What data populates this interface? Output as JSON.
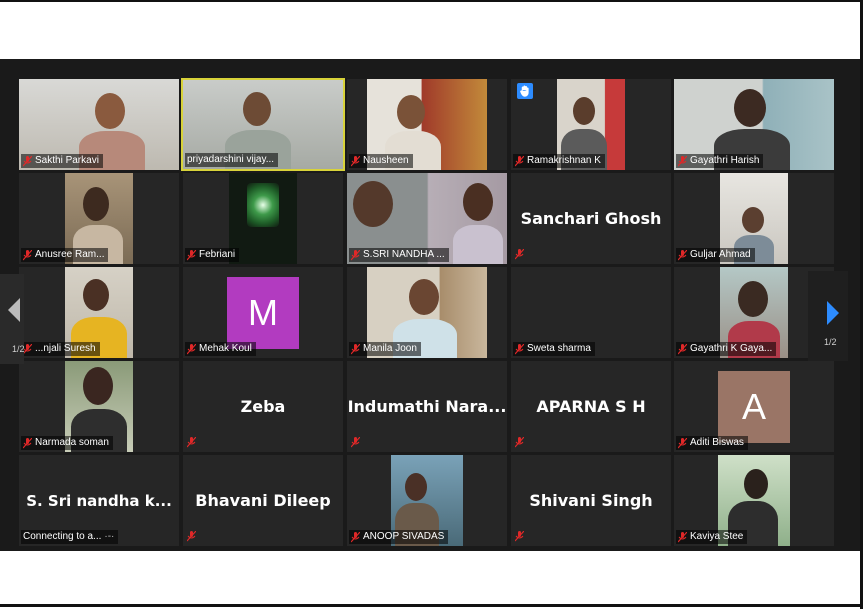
{
  "colors": {
    "background": "#1a1a1a",
    "tile": "#262626",
    "active_border": "#d8d33a",
    "muted_mic": "#e02828",
    "raise_hand": "#2d8cff",
    "avatar_m": "#b23bc0",
    "avatar_a": "#9a7566"
  },
  "pagination": {
    "left": "1/2",
    "right": "1/2"
  },
  "participants": [
    {
      "name": "Sakthi Parkavi"
    },
    {
      "name": "priyadarshini vijay..."
    },
    {
      "name": "Nausheen"
    },
    {
      "name": "Ramakrishnan K",
      "icon": "raise-hand-icon"
    },
    {
      "name": "Gayathri Harish"
    },
    {
      "name": "Anusree Ram..."
    },
    {
      "name": "Febriani"
    },
    {
      "name": "S.SRI NANDHA ..."
    },
    {
      "name": "Sanchari Ghosh"
    },
    {
      "name": "Guljar Ahmad"
    },
    {
      "name": "...njali Suresh"
    },
    {
      "name": "Mehak Koul",
      "avatar": "M"
    },
    {
      "name": "Manila Joon"
    },
    {
      "name": "Sweta sharma"
    },
    {
      "name": "Gayathri K Gaya..."
    },
    {
      "name": "Narmada soman"
    },
    {
      "name": "Zeba"
    },
    {
      "name": "Indumathi  Nara..."
    },
    {
      "name": "APARNA S H"
    },
    {
      "name": "Aditi Biswas",
      "avatar": "A"
    },
    {
      "name": "S. Sri nandha k...",
      "status": "Connecting to a..."
    },
    {
      "name": "Bhavani Dileep"
    },
    {
      "name": "ANOOP SIVADAS"
    },
    {
      "name": "Shivani Singh"
    },
    {
      "name": "Kaviya Stee"
    }
  ]
}
